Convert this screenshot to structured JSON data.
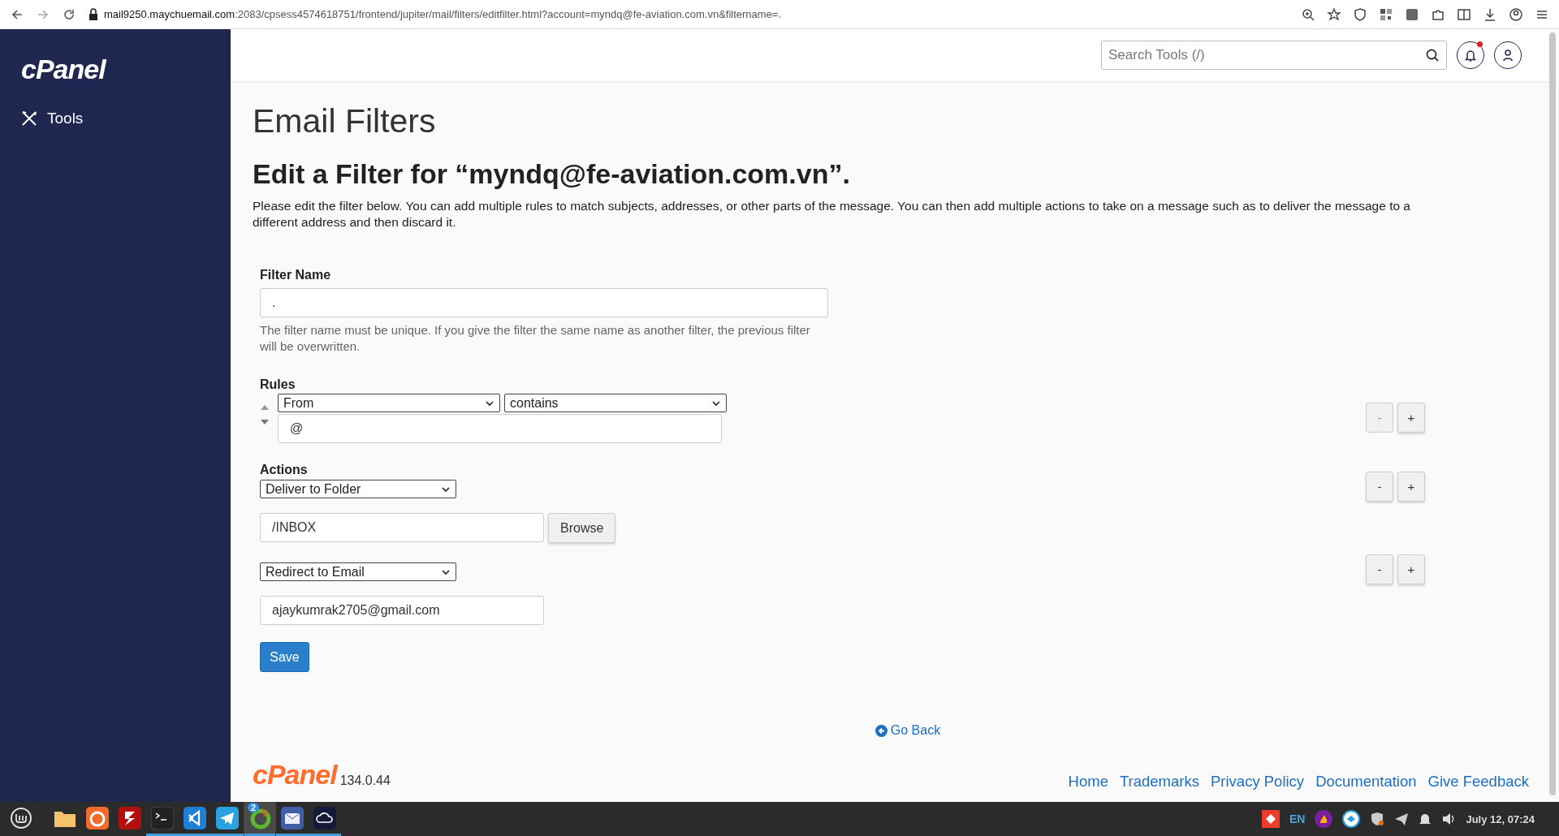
{
  "browser": {
    "url_host": "mail9250.maychuemail.com",
    "url_path": ":2083/cpsess4574618751/frontend/jupiter/mail/filters/editfilter.html?account=myndq@fe-aviation.com.vn&filtername=."
  },
  "sidebar": {
    "logo": "cPanel",
    "items": [
      {
        "label": "Tools"
      }
    ]
  },
  "header": {
    "search": {
      "placeholder": "Search Tools (/)"
    },
    "has_unread": true
  },
  "page": {
    "title": "Email Filters",
    "heading": "Edit a Filter for “myndq@fe-aviation.com.vn”.",
    "description": "Please edit the filter below. You can add multiple rules to match subjects, addresses, or other parts of the message. You can then add multiple actions to take on a message such as to deliver the message to a different address and then discard it."
  },
  "filter_name": {
    "label": "Filter Name",
    "value": ".",
    "hint": "The filter name must be unique. If you give the filter the same name as another filter, the previous filter will be overwritten."
  },
  "rules": {
    "label": "Rules",
    "items": [
      {
        "field": "From",
        "operator": "contains",
        "value": "@",
        "remove": {
          "label": "-",
          "disabled": true
        },
        "add": {
          "label": "+"
        }
      }
    ]
  },
  "actions": {
    "label": "Actions",
    "items": [
      {
        "kind": "folder",
        "action": "Deliver to Folder",
        "value": "/INBOX",
        "button": "Browse",
        "remove": {
          "label": "-",
          "disabled": false
        },
        "add": {
          "label": "+"
        }
      },
      {
        "kind": "email",
        "action": "Redirect to Email",
        "value": "ajaykumrak2705@gmail.com",
        "remove": {
          "label": "-",
          "disabled": false
        },
        "add": {
          "label": "+"
        }
      }
    ]
  },
  "save": "Save",
  "go_back": "Go Back",
  "footer": {
    "logo": "cPanel",
    "version": "134.0.44",
    "links": [
      "Home",
      "Trademarks",
      "Privacy Policy",
      "Documentation",
      "Give Feedback"
    ]
  },
  "taskbar": {
    "apps": [
      {
        "kind": "folder",
        "running": false,
        "selected": false
      },
      {
        "kind": "firefox",
        "running": false,
        "selected": false
      },
      {
        "kind": "filezilla",
        "running": false,
        "selected": false
      },
      {
        "kind": "terminal",
        "running": true,
        "selected": false
      },
      {
        "kind": "vscode",
        "running": true,
        "selected": false
      },
      {
        "kind": "telegram",
        "running": true,
        "selected": false
      },
      {
        "kind": "ring",
        "running": true,
        "selected": true,
        "badge": "2"
      },
      {
        "kind": "mail",
        "running": true,
        "selected": false
      },
      {
        "kind": "cloud",
        "running": true,
        "selected": false
      }
    ],
    "language": "EN",
    "clock": "July 12, 07:24"
  }
}
